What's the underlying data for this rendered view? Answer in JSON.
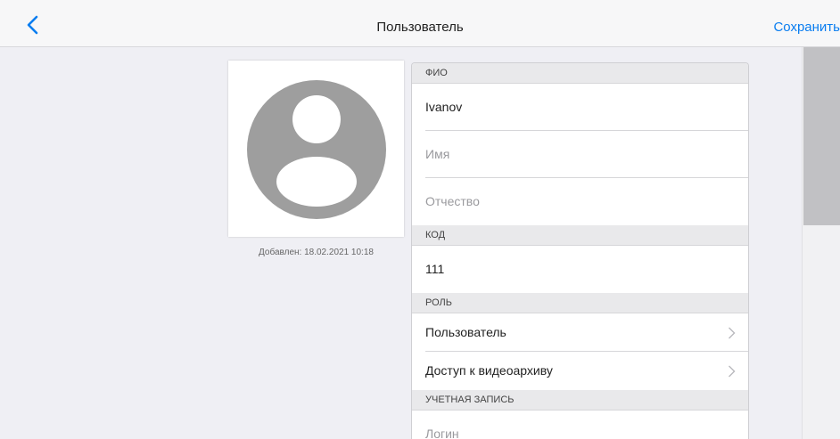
{
  "header": {
    "title": "Пользователь",
    "save_label": "Сохранить"
  },
  "photo": {
    "added_text": "Добавлен: 18.02.2021 10:18"
  },
  "form": {
    "sections": {
      "fio": "ФИО",
      "code": "КОД",
      "role": "РОЛЬ",
      "account": "УЧЕТНАЯ ЗАПИСЬ"
    },
    "last_name": "Ivanov",
    "first_name_placeholder": "Имя",
    "middle_name_placeholder": "Отчество",
    "code_value": "111",
    "role_value": "Пользователь",
    "archive_access": "Доступ к видеоархиву",
    "login_placeholder": "Логин"
  },
  "colors": {
    "accent": "#0a7df0",
    "avatar": "#9e9e9e"
  }
}
